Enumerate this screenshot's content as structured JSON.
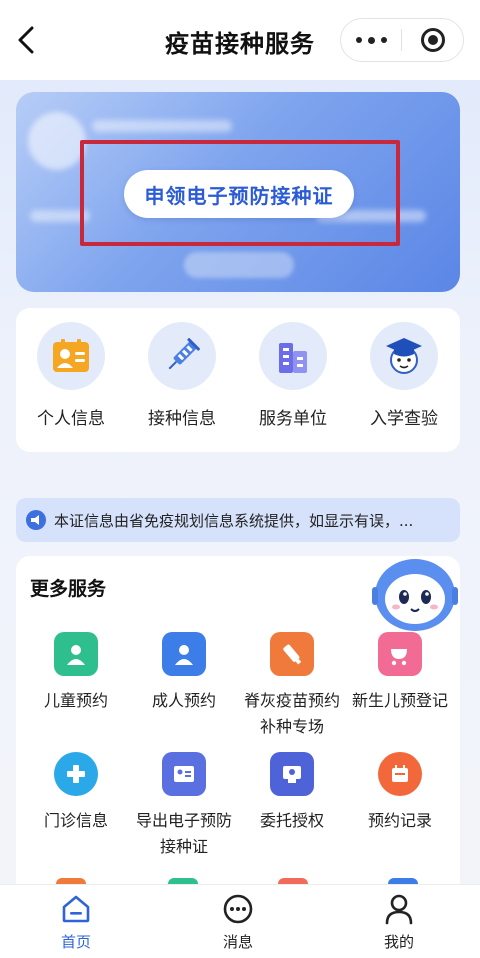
{
  "nav": {
    "title": "疫苗接种服务"
  },
  "hero": {
    "apply_button": "申领电子预防接种证"
  },
  "quick_entries": [
    {
      "label": "个人信息",
      "icon": "id-card-icon"
    },
    {
      "label": "接种信息",
      "icon": "syringe-icon"
    },
    {
      "label": "服务单位",
      "icon": "building-icon"
    },
    {
      "label": "入学查验",
      "icon": "graduate-icon"
    }
  ],
  "notice": {
    "text": "本证信息由省免疫规划信息系统提供，如显示有误，..."
  },
  "services": {
    "title": "更多服务",
    "items": [
      {
        "label": "儿童预约",
        "icon": "child-booking-icon",
        "color": "#2fbf8f"
      },
      {
        "label": "成人预约",
        "icon": "adult-booking-icon",
        "color": "#3d7de8"
      },
      {
        "label": "脊灰疫苗预约补种专场",
        "icon": "vaccine-vial-icon",
        "color": "#f07a3c"
      },
      {
        "label": "新生儿预登记",
        "icon": "stroller-icon",
        "color": "#f16b94"
      },
      {
        "label": "门诊信息",
        "icon": "clinic-plus-icon",
        "color": "#2aa8e8"
      },
      {
        "label": "导出电子预防接种证",
        "icon": "export-certificate-icon",
        "color": "#5a6fe0"
      },
      {
        "label": "委托授权",
        "icon": "authorization-icon",
        "color": "#4f63d8"
      },
      {
        "label": "预约记录",
        "icon": "calendar-record-icon",
        "color": "#f2683a"
      }
    ]
  },
  "tabbar": [
    {
      "label": "首页",
      "icon": "home-icon",
      "active": true
    },
    {
      "label": "消息",
      "icon": "message-icon",
      "active": false
    },
    {
      "label": "我的",
      "icon": "profile-icon",
      "active": false
    }
  ]
}
